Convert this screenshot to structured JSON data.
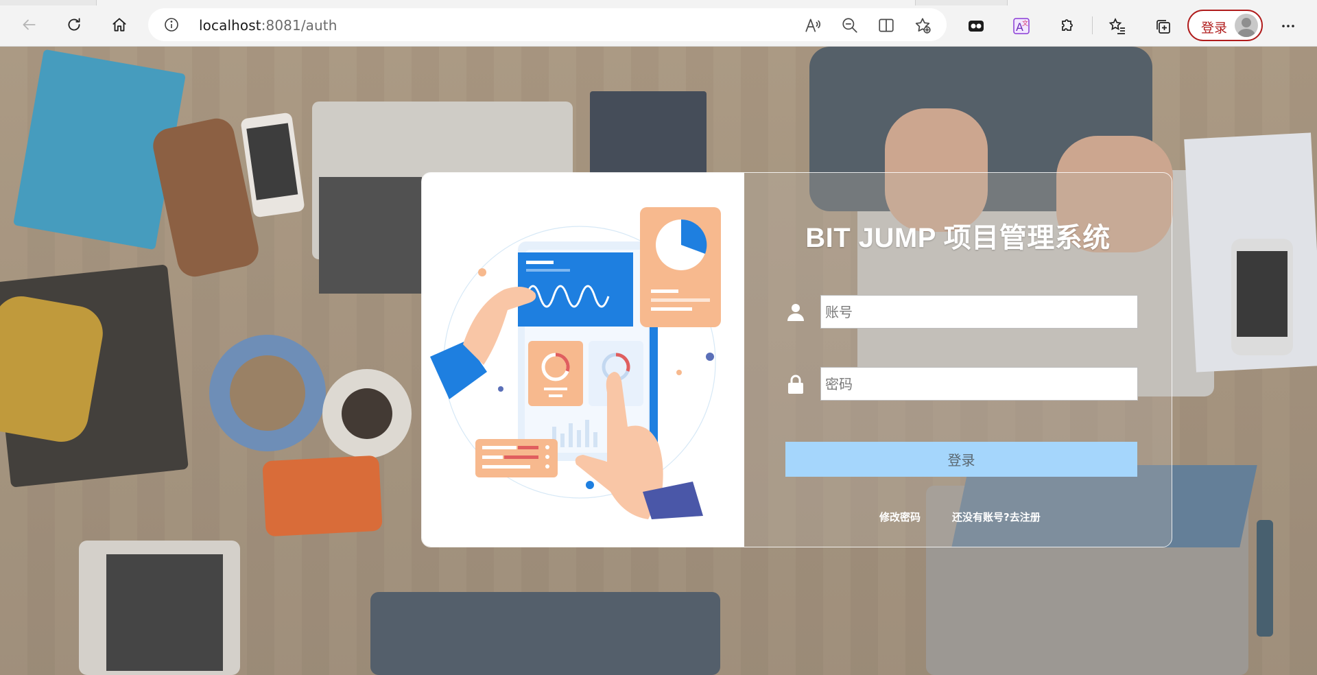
{
  "browser": {
    "url_host": "localhost",
    "url_rest": ":8081/auth",
    "profile_login_label": "登录"
  },
  "login": {
    "title": "BIT JUMP 项目管理系统",
    "account_placeholder": "账号",
    "password_placeholder": "密码",
    "submit_label": "登录",
    "change_password_link": "修改密码",
    "register_link": "还没有账号?去注册"
  },
  "colors": {
    "submit_button_bg": "#a5d6fc",
    "profile_pill_border": "#b01c1c",
    "illustration_blue": "#1e7fe0",
    "illustration_peach": "#f7b98e"
  },
  "icons": {
    "account": "user-icon",
    "password": "lock-icon"
  }
}
